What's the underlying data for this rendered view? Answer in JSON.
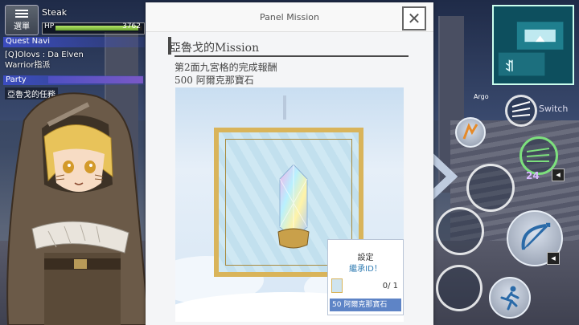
{
  "hud": {
    "menu_label": "選單",
    "player_name": "Steak",
    "hp_label": "HP",
    "hp_value": "3762",
    "hp_fraction": 0.95,
    "quest_header": "Quest Navi",
    "quest_line1": "[Q]Olovs : Da Elven",
    "quest_line2": "Warrior指派",
    "party_header": "Party",
    "party_member": "亞魯戈的任務"
  },
  "right_hud": {
    "npc_label": "Argo",
    "switch_label": "Switch",
    "count": "24",
    "colors": {
      "accent": "#d9b9ff",
      "minimap": "#0d4f5e"
    }
  },
  "panel": {
    "title": "Panel Mission",
    "close_icon": "close-icon",
    "mission_title": "亞魯戈的Mission",
    "desc_line1": "第2面九宮格的完成報酬",
    "desc_line2": "500 阿爾克那寶石",
    "popup_line1": "設定",
    "popup_line2": "繼承ID！",
    "item_count": "0/ 1",
    "item_name": "50 阿爾克那寶石",
    "colors": {
      "frame": "#d9b45a",
      "item_bar": "#5e84c6",
      "popup_text": "#2e7bb2"
    }
  }
}
